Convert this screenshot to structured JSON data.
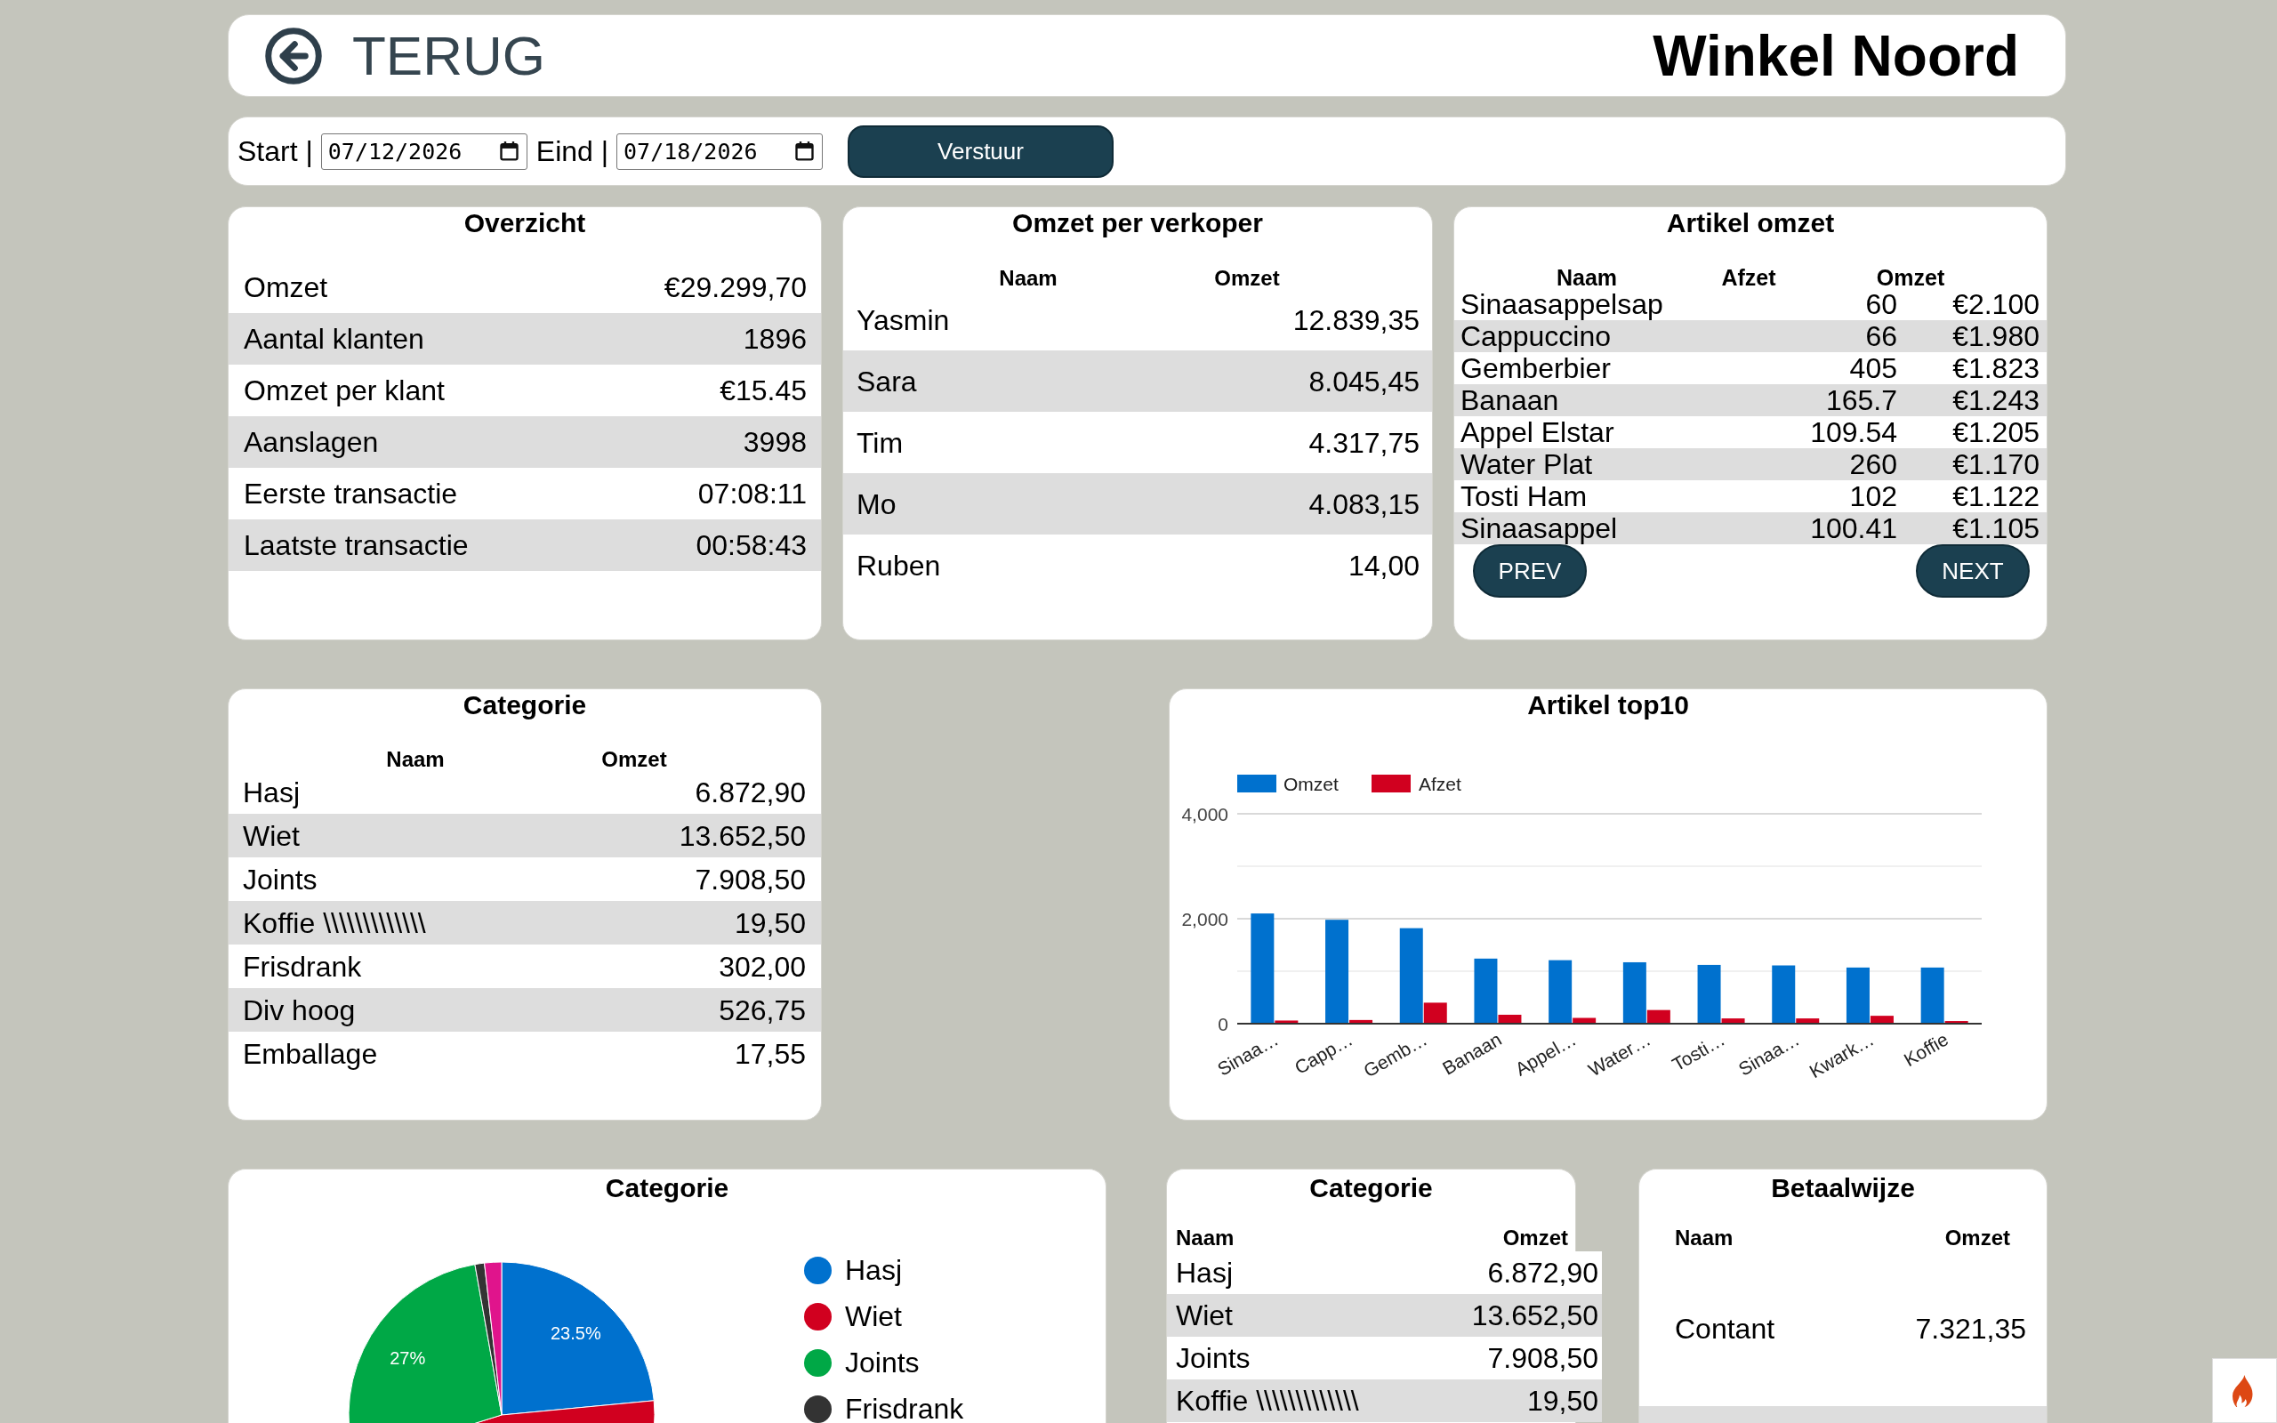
{
  "header": {
    "back_link": "TERUG",
    "title": "Winkel Noord"
  },
  "date_filter": {
    "start_label": "Start |",
    "start_value": "07/12/2026",
    "end_label": "Eind |",
    "end_value": "07/18/2026",
    "submit_button": "Verstuur"
  },
  "overview": {
    "title": "Overzicht",
    "rows": [
      {
        "label": "Omzet",
        "value": "€29.299,70"
      },
      {
        "label": "Aantal klanten",
        "value": "1896"
      },
      {
        "label": "Omzet per klant",
        "value": "€15.45"
      },
      {
        "label": "Aanslagen",
        "value": "3998"
      },
      {
        "label": "Eerste transactie",
        "value": "07:08:11"
      },
      {
        "label": "Laatste transactie",
        "value": "00:58:43"
      }
    ]
  },
  "sales_per_seller": {
    "title": "Omzet per verkoper",
    "columns": [
      "Naam",
      "Omzet"
    ],
    "rows": [
      {
        "naam": "Yasmin",
        "omzet": "12.839,35"
      },
      {
        "naam": "Sara",
        "omzet": "8.045,45"
      },
      {
        "naam": "Tim",
        "omzet": "4.317,75"
      },
      {
        "naam": "Mo",
        "omzet": "4.083,15"
      },
      {
        "naam": "Ruben",
        "omzet": "14,00"
      }
    ]
  },
  "article_revenue": {
    "title": "Artikel omzet",
    "columns": [
      "Naam",
      "Afzet",
      "Omzet"
    ],
    "rows": [
      {
        "naam": "Sinaasappelsap",
        "afzet": "60",
        "omzet": "€2.100"
      },
      {
        "naam": "Cappuccino",
        "afzet": "66",
        "omzet": "€1.980"
      },
      {
        "naam": "Gemberbier",
        "afzet": "405",
        "omzet": "€1.823"
      },
      {
        "naam": "Banaan",
        "afzet": "165.7",
        "omzet": "€1.243"
      },
      {
        "naam": "Appel Elstar",
        "afzet": "109.54",
        "omzet": "€1.205"
      },
      {
        "naam": "Water Plat",
        "afzet": "260",
        "omzet": "€1.170"
      },
      {
        "naam": "Tosti Ham",
        "afzet": "102",
        "omzet": "€1.122"
      },
      {
        "naam": "Sinaasappel",
        "afzet": "100.41",
        "omzet": "€1.105"
      }
    ],
    "prev_button": "PREV",
    "next_button": "NEXT"
  },
  "category_table": {
    "title": "Categorie",
    "columns": [
      "Naam",
      "Omzet"
    ],
    "rows": [
      {
        "naam": "Hasj",
        "omzet": "6.872,90"
      },
      {
        "naam": "Wiet",
        "omzet": "13.652,50"
      },
      {
        "naam": "Joints",
        "omzet": "7.908,50"
      },
      {
        "naam": "Koffie \\\\\\\\\\\\\\\\\\\\\\\\\\",
        "omzet": "19,50"
      },
      {
        "naam": "Frisdrank",
        "omzet": "302,00"
      },
      {
        "naam": "Div hoog",
        "omzet": "526,75"
      },
      {
        "naam": "Emballage",
        "omzet": "17,55"
      }
    ]
  },
  "top10_chart": {
    "chart_data": {
      "type": "bar",
      "title": "Artikel top10",
      "legend": "top",
      "categories": [
        "Sinaa…",
        "Capp…",
        "Gemb…",
        "Banaan",
        "Appel…",
        "Water…",
        "Tosti…",
        "Sinaa…",
        "Kwark…",
        "Koffie"
      ],
      "series": [
        {
          "name": "Omzet",
          "color": "#0071ce",
          "values": [
            2100,
            1980,
            1820,
            1240,
            1210,
            1170,
            1120,
            1110,
            1070,
            1070
          ]
        },
        {
          "name": "Afzet",
          "color": "#d1001f",
          "values": [
            60,
            70,
            400,
            170,
            110,
            260,
            100,
            100,
            150,
            50
          ]
        }
      ],
      "ylim": [
        0,
        4000
      ],
      "yticks": [
        0,
        {
          "value": 2000,
          "label": "2,000"
        },
        {
          "value": 4000,
          "label": "4,000"
        }
      ]
    }
  },
  "category_pie": {
    "chart_data": {
      "type": "pie",
      "title": "Categorie",
      "legend": "right",
      "categories": [
        "Hasj",
        "Wiet",
        "Joints",
        "Frisdrank",
        null
      ],
      "values": [
        23.5,
        46.7,
        27.0,
        1.0,
        1.8
      ],
      "colors": [
        "#0071ce",
        "#d1001f",
        "#00a846",
        "#333333",
        "#e0148c"
      ],
      "value_labels": [
        "23.5%",
        null,
        "27%",
        null,
        null
      ]
    }
  },
  "category_table_2": {
    "title": "Categorie",
    "columns": [
      "Naam",
      "Omzet"
    ],
    "rows": [
      {
        "naam": "Hasj",
        "omzet": "6.872,90"
      },
      {
        "naam": "Wiet",
        "omzet": "13.652,50"
      },
      {
        "naam": "Joints",
        "omzet": "7.908,50"
      },
      {
        "naam": "Koffie \\\\\\\\\\\\\\\\\\\\\\\\\\",
        "omzet": "19,50"
      }
    ]
  },
  "payment_methods": {
    "title": "Betaalwijze",
    "columns": [
      "Naam",
      "Omzet"
    ],
    "rows": [
      {
        "naam": "Contant",
        "omzet": "7.321,35"
      }
    ]
  }
}
